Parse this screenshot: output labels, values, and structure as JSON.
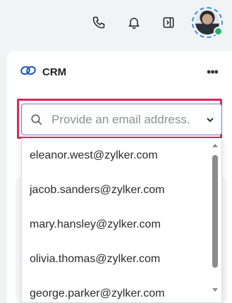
{
  "topbar": {
    "icons": [
      "phone-icon",
      "bell-icon",
      "sidebar-toggle-icon",
      "avatar"
    ]
  },
  "panel": {
    "title": "CRM",
    "icon": "crm-link-icon",
    "more_label": "•••"
  },
  "email_select": {
    "placeholder": "Provide an email address.",
    "value": "",
    "options": [
      "eleanor.west@zylker.com",
      "jacob.sanders@zylker.com",
      "mary.hansley@zylker.com",
      "olivia.thomas@zylker.com",
      "george.parker@zylker.com"
    ]
  },
  "colors": {
    "highlight": "#e0245e",
    "focus_border": "#6b7cd8",
    "online": "#1fb36b",
    "crm_icon": "#1a56c4"
  }
}
